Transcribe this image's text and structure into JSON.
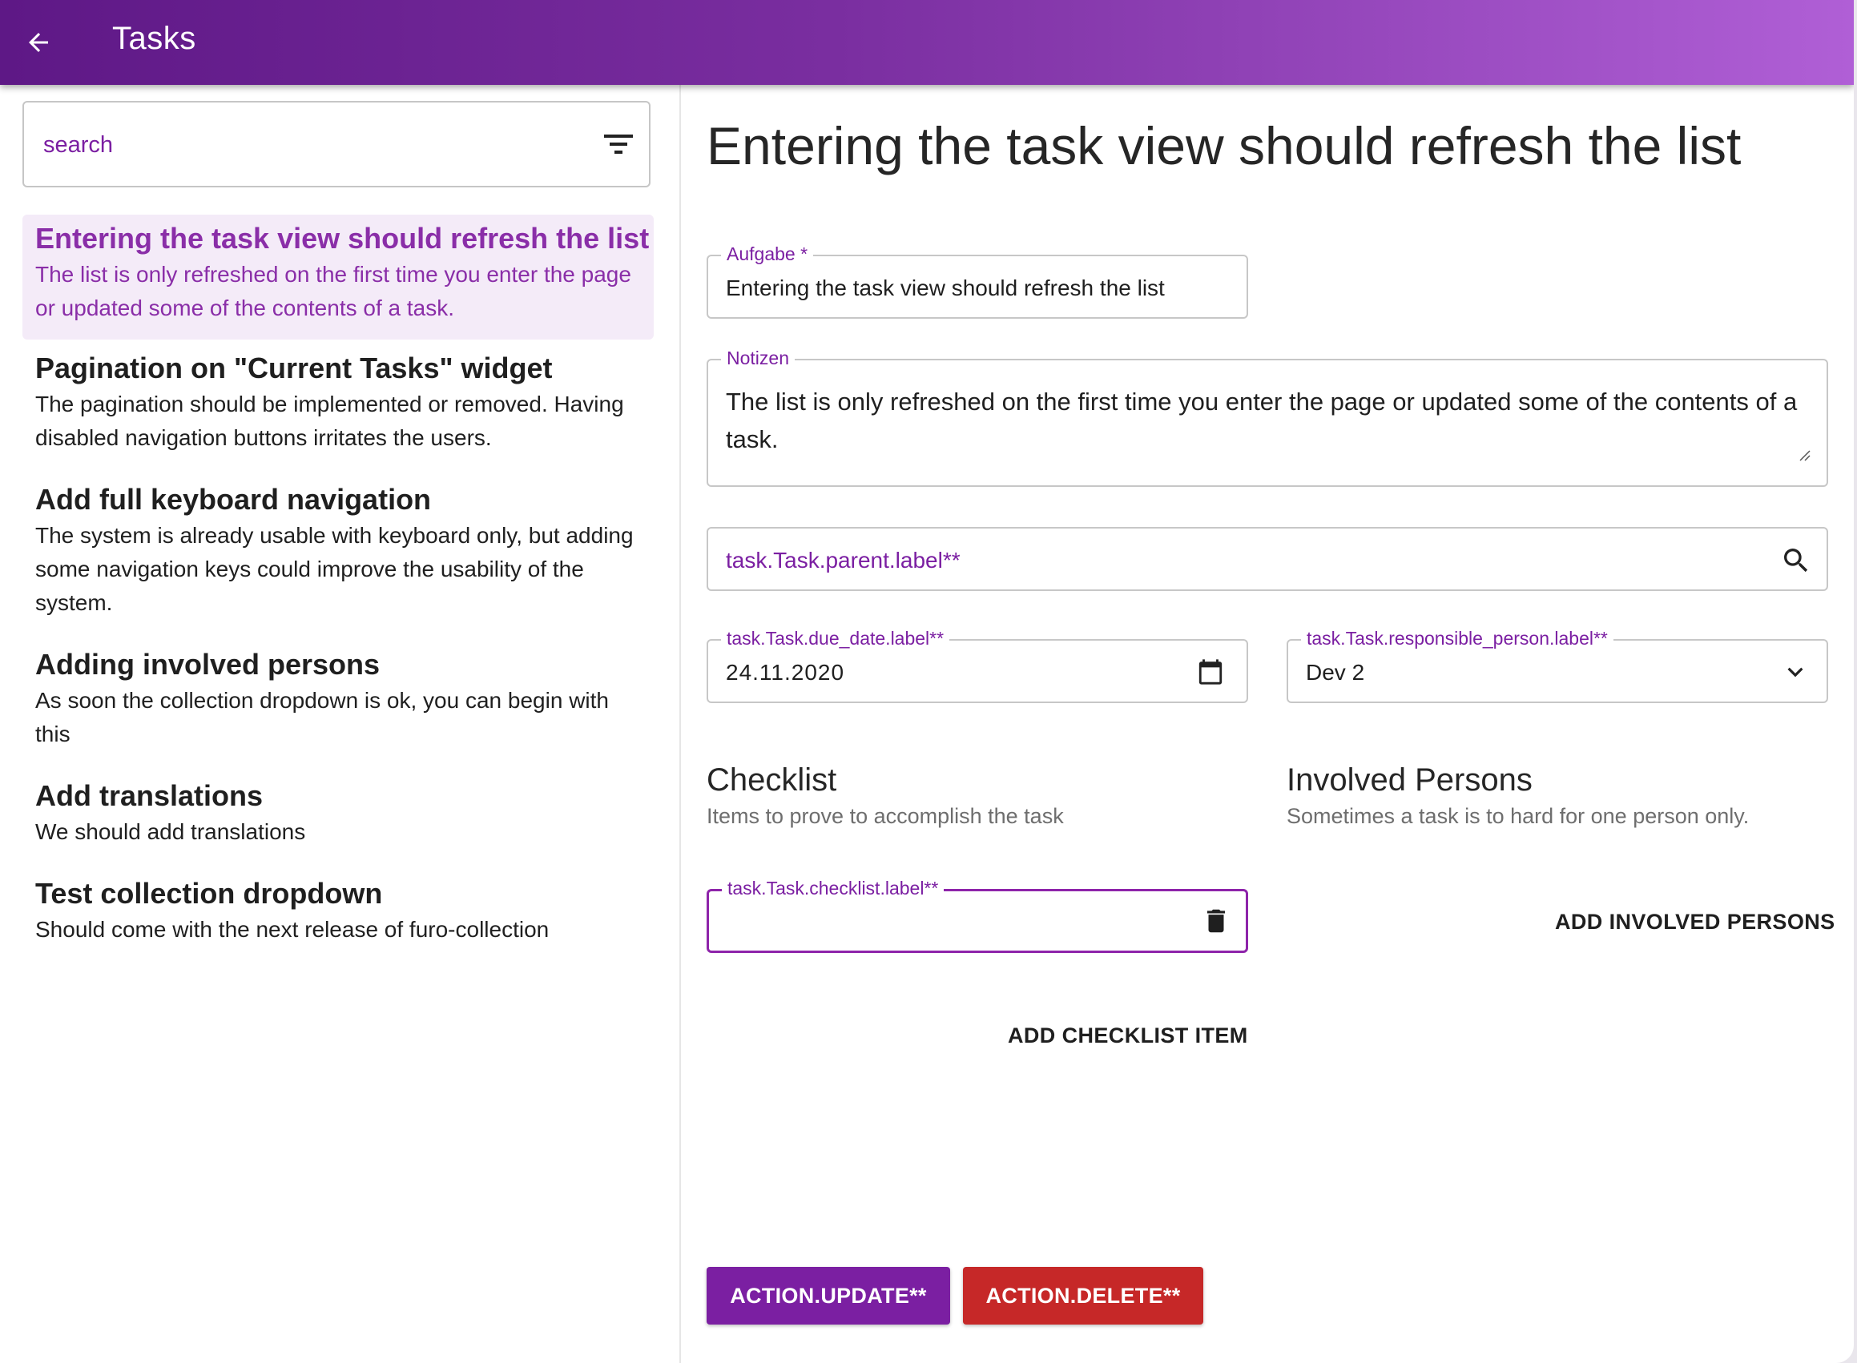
{
  "colors": {
    "primary": "#7b1fa2",
    "danger": "#c62828",
    "header_start": "#5e1886",
    "header_end": "#b05fd6"
  },
  "header": {
    "title": "Tasks",
    "back_icon": "arrow-left-icon"
  },
  "sidebar": {
    "search": {
      "placeholder": "search",
      "value": ""
    },
    "filter_icon": "filter-icon",
    "tasks": [
      {
        "title": "Entering the task view should refresh the list",
        "description": "The list is only refreshed on the first time you enter the page or updated some of the contents of a task.",
        "selected": true
      },
      {
        "title": "Pagination on \"Current Tasks\" widget",
        "description": "The pagination should be implemented or removed. Having disabled navigation buttons irritates the users."
      },
      {
        "title": "Add full keyboard navigation",
        "description": "The system is already usable with keyboard only, but adding some navigation keys could improve the usability of the system."
      },
      {
        "title": "Adding involved persons",
        "description": "As soon the collection dropdown is ok, you can begin with this"
      },
      {
        "title": "Add translations",
        "description": "We should add translations"
      },
      {
        "title": "Test collection dropdown",
        "description": "Should come with the next release of furo-collection"
      }
    ]
  },
  "detail": {
    "title": "Entering the task view should refresh the list",
    "aufgabe": {
      "label": "Aufgabe *",
      "value": "Entering the task view should refresh the list"
    },
    "notizen": {
      "label": "Notizen",
      "value": "The list is only refreshed on the first time you enter the page or updated some of the contents of a task."
    },
    "parent": {
      "placeholder": "task.Task.parent.label**",
      "icon": "search-icon"
    },
    "due_date": {
      "label": "task.Task.due_date.label**",
      "value": "24.11.2020",
      "icon": "calendar-icon"
    },
    "responsible": {
      "label": "task.Task.responsible_person.label**",
      "value": "Dev 2",
      "icon": "chevron-down-icon"
    },
    "checklist": {
      "title": "Checklist",
      "subtitle": "Items to prove to accomplish the task",
      "item_label": "task.Task.checklist.label**",
      "item_value": "",
      "delete_icon": "trash-icon",
      "add_label": "ADD CHECKLIST ITEM"
    },
    "involved": {
      "title": "Involved Persons",
      "subtitle": "Sometimes a task is to hard for one person only.",
      "add_label": "ADD INVOLVED PERSONS"
    },
    "actions": {
      "update": "ACTION.UPDATE**",
      "delete": "ACTION.DELETE**"
    }
  }
}
